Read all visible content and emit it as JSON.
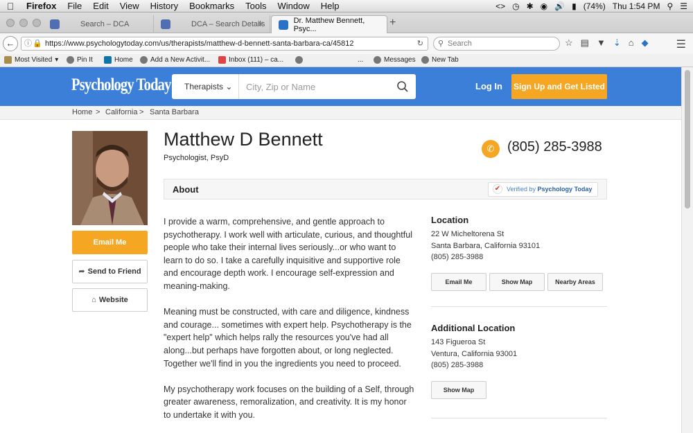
{
  "menubar": {
    "app": "Firefox",
    "items": [
      "File",
      "Edit",
      "View",
      "History",
      "Bookmarks",
      "Tools",
      "Window",
      "Help"
    ],
    "battery": "(74%)",
    "clock": "Thu 1:54 PM"
  },
  "tabs": [
    {
      "label": "Search – DCA"
    },
    {
      "label": "DCA – Search Details"
    },
    {
      "label": "Dr. Matthew Bennett, Psyc..."
    }
  ],
  "urlbar": {
    "url": "https://www.psychologytoday.com/us/therapists/matthew-d-bennett-santa-barbara-ca/45812",
    "search_placeholder": "Search"
  },
  "bookmarks": [
    "Most Visited",
    "Pin It",
    "Home",
    "Add a New Activit...",
    "Inbox (111) – ca...",
    "...",
    "Messages",
    "New Tab"
  ],
  "site": {
    "logo": "Psychology Today",
    "search_dropdown": "Therapists",
    "search_placeholder": "City, Zip or Name",
    "login": "Log In",
    "signup": "Sign Up and Get Listed"
  },
  "breadcrumb": {
    "home": "Home",
    "sep": ">",
    "state": "California",
    "city": "Santa Barbara"
  },
  "profile": {
    "name": "Matthew D Bennett",
    "title": "Psychologist, PsyD",
    "phone": "(805) 285-3988",
    "email_btn": "Email Me",
    "send_btn": "Send to Friend",
    "website_btn": "Website"
  },
  "about": {
    "label": "About",
    "verified_prefix": "Verified by",
    "verified_brand": "Psychology Today",
    "paragraphs": [
      "I provide a warm, comprehensive, and gentle approach to psychotherapy. I work well with articulate, curious, and thoughtful people who take their internal lives seriously...or who want to learn to do so. I take a carefully inquisitive and supportive role and encourage depth work. I encourage self-expression and meaning-making.",
      "Meaning must be constructed, with care and diligence, kindness and courage... sometimes with expert help. Psychotherapy is the \"expert help\" which helps rally the resources you've had all along...but perhaps have forgotten about, or long neglected. Together we'll find in you the ingredients you need to proceed.",
      "My psychotherapy work focuses on the building of a Self, through greater awareness, remoralization, and creativity. It is my honor to undertake it with you."
    ]
  },
  "location": {
    "heading": "Location",
    "street": "22 W Micheltorena St",
    "city": "Santa Barbara, California 93101",
    "phone": "(805) 285-3988",
    "btn_email": "Email Me",
    "btn_map": "Show Map",
    "btn_nearby": "Nearby Areas"
  },
  "additional_location": {
    "heading": "Additional Location",
    "street": "143 Figueroa St",
    "city": "Ventura, California 93001",
    "phone": "(805) 285-3988",
    "btn_map": "Show Map"
  },
  "colors": {
    "brand_blue": "#3c7fd8",
    "accent_orange": "#f5a623"
  }
}
